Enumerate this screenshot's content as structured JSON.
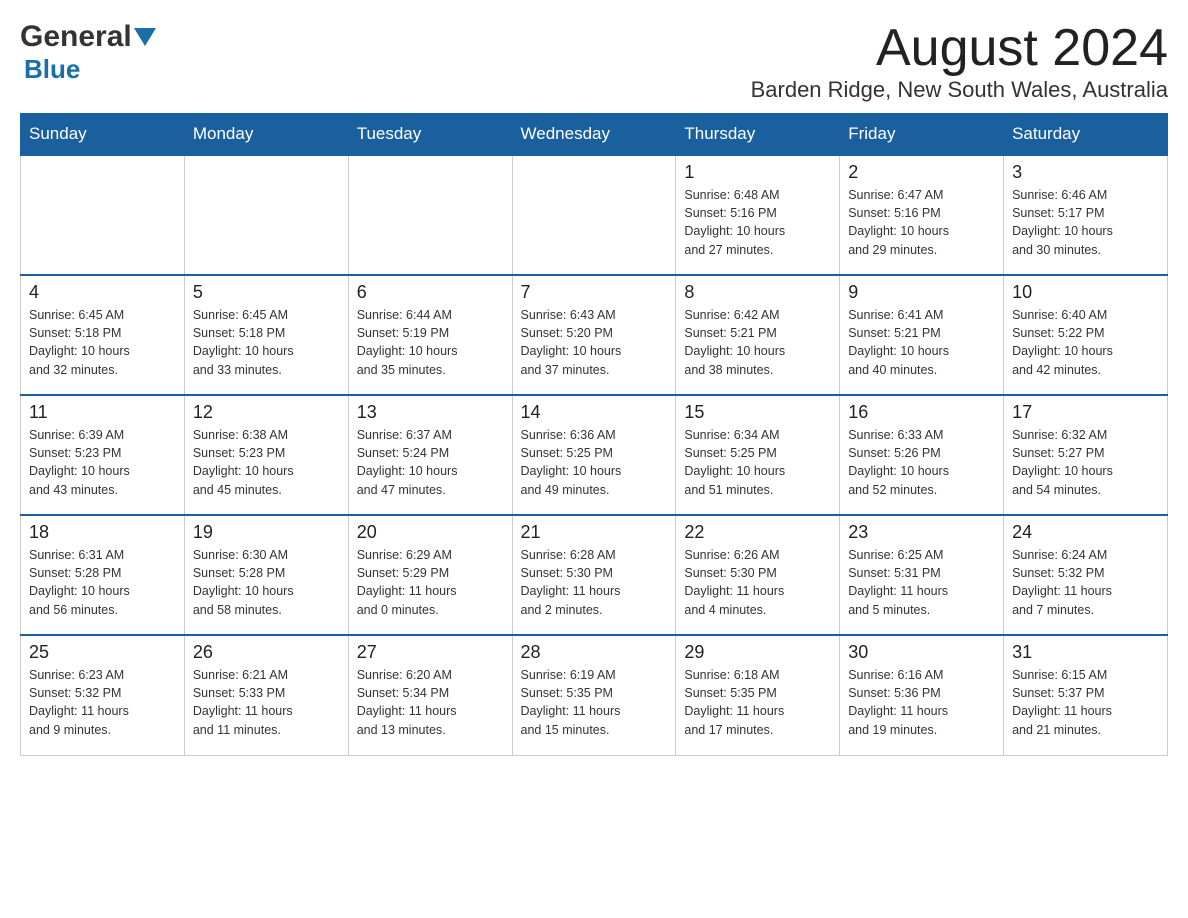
{
  "logo": {
    "general": "General",
    "blue": "Blue"
  },
  "title": "August 2024",
  "subtitle": "Barden Ridge, New South Wales, Australia",
  "weekdays": [
    "Sunday",
    "Monday",
    "Tuesday",
    "Wednesday",
    "Thursday",
    "Friday",
    "Saturday"
  ],
  "weeks": [
    [
      {
        "day": "",
        "info": ""
      },
      {
        "day": "",
        "info": ""
      },
      {
        "day": "",
        "info": ""
      },
      {
        "day": "",
        "info": ""
      },
      {
        "day": "1",
        "info": "Sunrise: 6:48 AM\nSunset: 5:16 PM\nDaylight: 10 hours\nand 27 minutes."
      },
      {
        "day": "2",
        "info": "Sunrise: 6:47 AM\nSunset: 5:16 PM\nDaylight: 10 hours\nand 29 minutes."
      },
      {
        "day": "3",
        "info": "Sunrise: 6:46 AM\nSunset: 5:17 PM\nDaylight: 10 hours\nand 30 minutes."
      }
    ],
    [
      {
        "day": "4",
        "info": "Sunrise: 6:45 AM\nSunset: 5:18 PM\nDaylight: 10 hours\nand 32 minutes."
      },
      {
        "day": "5",
        "info": "Sunrise: 6:45 AM\nSunset: 5:18 PM\nDaylight: 10 hours\nand 33 minutes."
      },
      {
        "day": "6",
        "info": "Sunrise: 6:44 AM\nSunset: 5:19 PM\nDaylight: 10 hours\nand 35 minutes."
      },
      {
        "day": "7",
        "info": "Sunrise: 6:43 AM\nSunset: 5:20 PM\nDaylight: 10 hours\nand 37 minutes."
      },
      {
        "day": "8",
        "info": "Sunrise: 6:42 AM\nSunset: 5:21 PM\nDaylight: 10 hours\nand 38 minutes."
      },
      {
        "day": "9",
        "info": "Sunrise: 6:41 AM\nSunset: 5:21 PM\nDaylight: 10 hours\nand 40 minutes."
      },
      {
        "day": "10",
        "info": "Sunrise: 6:40 AM\nSunset: 5:22 PM\nDaylight: 10 hours\nand 42 minutes."
      }
    ],
    [
      {
        "day": "11",
        "info": "Sunrise: 6:39 AM\nSunset: 5:23 PM\nDaylight: 10 hours\nand 43 minutes."
      },
      {
        "day": "12",
        "info": "Sunrise: 6:38 AM\nSunset: 5:23 PM\nDaylight: 10 hours\nand 45 minutes."
      },
      {
        "day": "13",
        "info": "Sunrise: 6:37 AM\nSunset: 5:24 PM\nDaylight: 10 hours\nand 47 minutes."
      },
      {
        "day": "14",
        "info": "Sunrise: 6:36 AM\nSunset: 5:25 PM\nDaylight: 10 hours\nand 49 minutes."
      },
      {
        "day": "15",
        "info": "Sunrise: 6:34 AM\nSunset: 5:25 PM\nDaylight: 10 hours\nand 51 minutes."
      },
      {
        "day": "16",
        "info": "Sunrise: 6:33 AM\nSunset: 5:26 PM\nDaylight: 10 hours\nand 52 minutes."
      },
      {
        "day": "17",
        "info": "Sunrise: 6:32 AM\nSunset: 5:27 PM\nDaylight: 10 hours\nand 54 minutes."
      }
    ],
    [
      {
        "day": "18",
        "info": "Sunrise: 6:31 AM\nSunset: 5:28 PM\nDaylight: 10 hours\nand 56 minutes."
      },
      {
        "day": "19",
        "info": "Sunrise: 6:30 AM\nSunset: 5:28 PM\nDaylight: 10 hours\nand 58 minutes."
      },
      {
        "day": "20",
        "info": "Sunrise: 6:29 AM\nSunset: 5:29 PM\nDaylight: 11 hours\nand 0 minutes."
      },
      {
        "day": "21",
        "info": "Sunrise: 6:28 AM\nSunset: 5:30 PM\nDaylight: 11 hours\nand 2 minutes."
      },
      {
        "day": "22",
        "info": "Sunrise: 6:26 AM\nSunset: 5:30 PM\nDaylight: 11 hours\nand 4 minutes."
      },
      {
        "day": "23",
        "info": "Sunrise: 6:25 AM\nSunset: 5:31 PM\nDaylight: 11 hours\nand 5 minutes."
      },
      {
        "day": "24",
        "info": "Sunrise: 6:24 AM\nSunset: 5:32 PM\nDaylight: 11 hours\nand 7 minutes."
      }
    ],
    [
      {
        "day": "25",
        "info": "Sunrise: 6:23 AM\nSunset: 5:32 PM\nDaylight: 11 hours\nand 9 minutes."
      },
      {
        "day": "26",
        "info": "Sunrise: 6:21 AM\nSunset: 5:33 PM\nDaylight: 11 hours\nand 11 minutes."
      },
      {
        "day": "27",
        "info": "Sunrise: 6:20 AM\nSunset: 5:34 PM\nDaylight: 11 hours\nand 13 minutes."
      },
      {
        "day": "28",
        "info": "Sunrise: 6:19 AM\nSunset: 5:35 PM\nDaylight: 11 hours\nand 15 minutes."
      },
      {
        "day": "29",
        "info": "Sunrise: 6:18 AM\nSunset: 5:35 PM\nDaylight: 11 hours\nand 17 minutes."
      },
      {
        "day": "30",
        "info": "Sunrise: 6:16 AM\nSunset: 5:36 PM\nDaylight: 11 hours\nand 19 minutes."
      },
      {
        "day": "31",
        "info": "Sunrise: 6:15 AM\nSunset: 5:37 PM\nDaylight: 11 hours\nand 21 minutes."
      }
    ]
  ]
}
